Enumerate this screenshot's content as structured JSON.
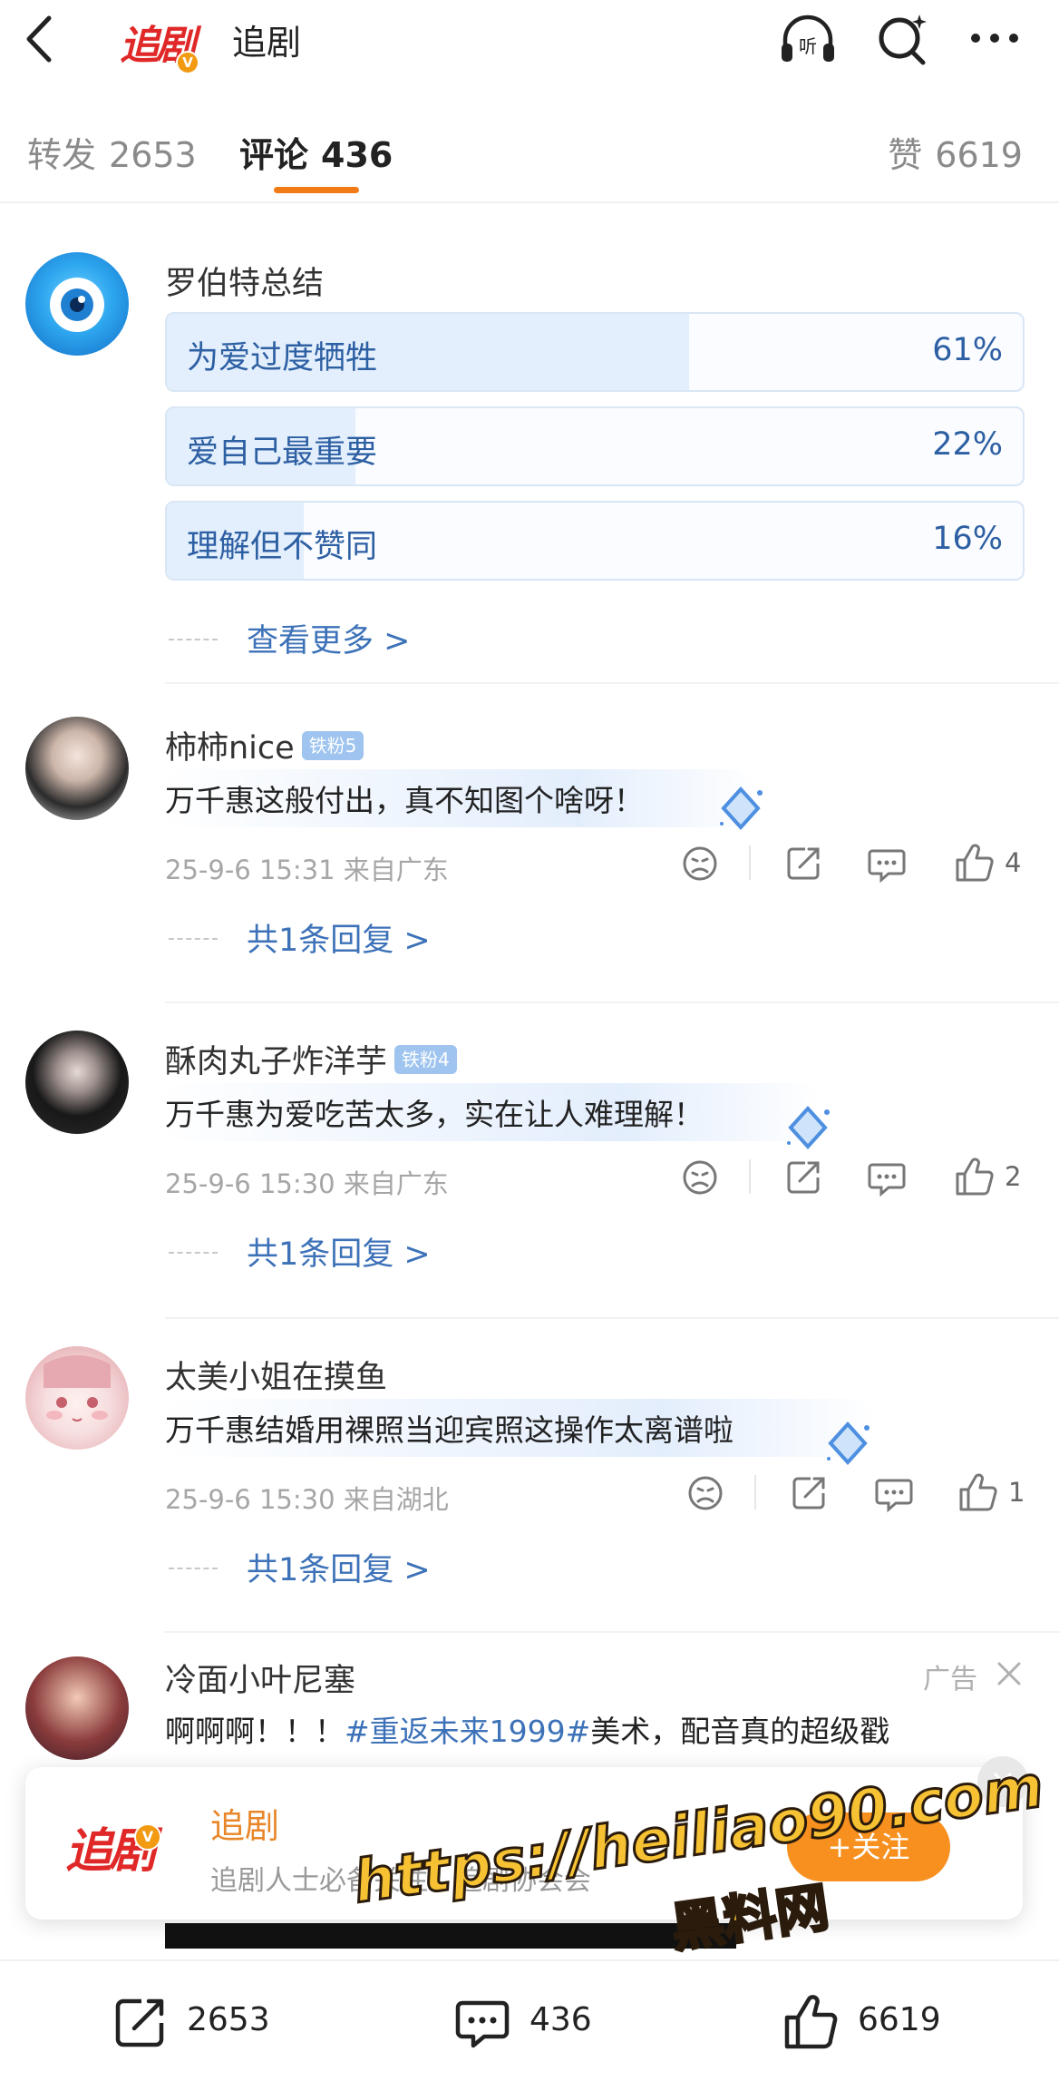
{
  "nav": {
    "title": "追剧",
    "logo_text": "追剧",
    "verified_mark": "V"
  },
  "tabs": {
    "repost": {
      "label": "转发",
      "count": "2653"
    },
    "comment": {
      "label": "评论",
      "count": "436"
    },
    "like": {
      "label": "赞",
      "count": "6619"
    }
  },
  "poll": {
    "author": "罗伯特总结",
    "options": [
      {
        "label": "为爱过度牺牲",
        "percent": "61%",
        "share": 0.61
      },
      {
        "label": "爱自己最重要",
        "percent": "22%",
        "share": 0.22
      },
      {
        "label": "理解但不赞同",
        "percent": "16%",
        "share": 0.16
      }
    ],
    "more_label": "查看更多 >"
  },
  "comments": [
    {
      "name": "柿柿nice",
      "badge": "铁粉5",
      "text": "万千惠这般付出，真不知图个啥呀！",
      "time": "25-9-6 15:31",
      "location": "来自广东",
      "likes": "4",
      "replies": "共1条回复 >"
    },
    {
      "name": "酥肉丸子炸洋芋",
      "badge": "铁粉4",
      "text": "万千惠为爱吃苦太多，实在让人难理解！",
      "time": "25-9-6 15:30",
      "location": "来自广东",
      "likes": "2",
      "replies": "共1条回复 >"
    },
    {
      "name": "太美小姐在摸鱼",
      "badge": "",
      "text": "万千惠结婚用裸照当迎宾照这操作太离谱啦",
      "time": "25-9-6 15:30",
      "location": "来自湖北",
      "likes": "1",
      "replies": "共1条回复 >"
    }
  ],
  "ad": {
    "name": "冷面小叶尼塞",
    "tag": "广告",
    "text_prefix": "啊啊啊！！！",
    "topic": "#重返未来1999#",
    "text_suffix": "美术，配音真的超级戳"
  },
  "float_card": {
    "logo_text": "追剧",
    "verified_mark": "V",
    "title": "追剧",
    "desc": "追剧人士必备关注！追剧协会会",
    "follow_label": "+关注"
  },
  "watermark": {
    "url": "https://heiliao90.com",
    "site": "黑料网"
  },
  "bottom_bar": {
    "repost_count": "2653",
    "comment_count": "436",
    "like_count": "6619"
  },
  "colors": {
    "accent": "#f27b16",
    "link": "#3d72b8",
    "brand_red": "#e02828",
    "poll_fill": "#e3effc"
  },
  "icons": [
    "back-icon",
    "listen-icon",
    "search-icon",
    "more-icon",
    "dislike-icon",
    "share-icon",
    "comment-icon",
    "like-icon",
    "close-icon",
    "gem-icon"
  ]
}
